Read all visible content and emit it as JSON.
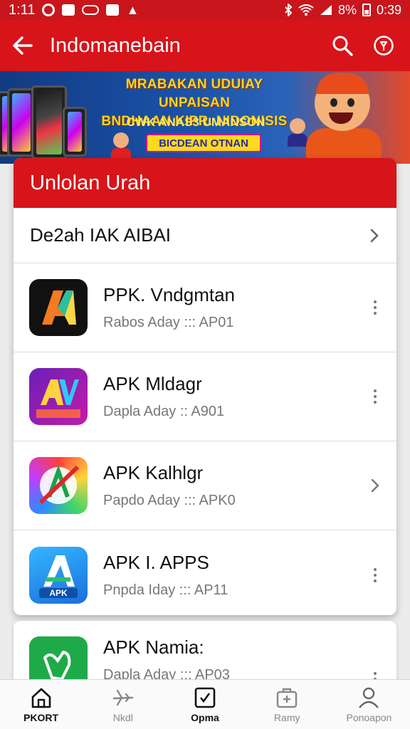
{
  "status_bar": {
    "time": "1:11",
    "battery": "8%",
    "clock_right": "0:39"
  },
  "app_bar": {
    "title": "Indomanebain"
  },
  "banner": {
    "headline_1": "MRABAKAN UDUIAY UNPAISAN",
    "headline_2": "BNDHAAN KIPR. NIDONISIS",
    "subline": "CWK ANAS3 UMANSON",
    "cta": "BICDEAN OTNAN"
  },
  "card": {
    "header": "Unlolan Urah",
    "link_row": "De2ah IAK AIBAI",
    "apps": [
      {
        "name": "PPK. Vndgmtan",
        "subtitle": "Rabos Aday ::: AP01",
        "icon": "apk-a-black-icon",
        "trailing": "more"
      },
      {
        "name": "APK Mldagr",
        "subtitle": "Dapla Aday :: A901",
        "icon": "apk-purple-icon",
        "trailing": "more"
      },
      {
        "name": "APK Kalhlgr",
        "subtitle": "Papdo Aday ::: APK0",
        "icon": "apk-rainbow-icon",
        "trailing": "chevron"
      },
      {
        "name": "APK I. APPS",
        "subtitle": "Pnpda Iday ::: AP11",
        "icon": "apk-blue-icon",
        "trailing": "more"
      }
    ]
  },
  "lower_row": {
    "name": "APK Namia:",
    "subtitle": "Dapla Aday ::: AP03",
    "icon": "apk-green-icon"
  },
  "bottom_nav": [
    {
      "label": "PKORT",
      "icon": "home-icon",
      "active": true
    },
    {
      "label": "Nkdl",
      "icon": "plane-icon",
      "active": false
    },
    {
      "label": "Opma",
      "icon": "check-box-icon",
      "active": true
    },
    {
      "label": "Ramy",
      "icon": "briefcase-icon",
      "active": false
    },
    {
      "label": "Ponoapon",
      "icon": "person-icon",
      "active": false
    }
  ],
  "colors": {
    "brand_red": "#d7141a",
    "status_red": "#c8161c"
  }
}
